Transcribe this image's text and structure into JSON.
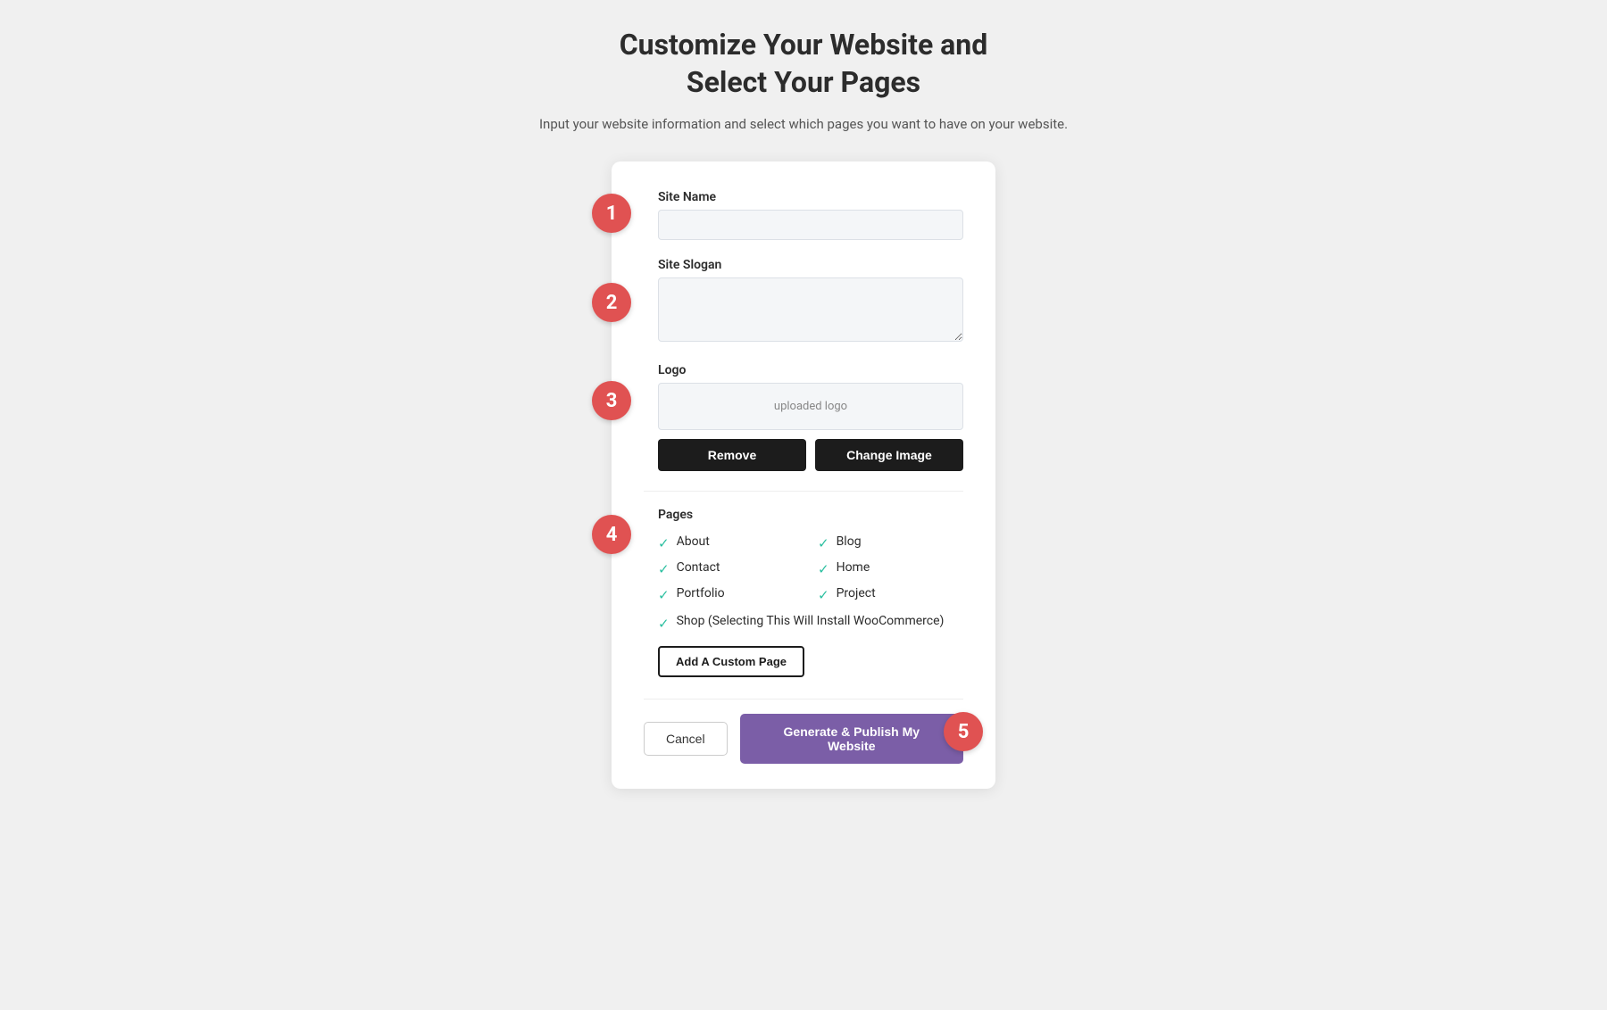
{
  "header": {
    "title_line1": "Customize Your Website and",
    "title_line2": "Select Your Pages",
    "subtitle": "Input your website information and select which pages you want to have on your website."
  },
  "form": {
    "site_name_label": "Site Name",
    "site_name_placeholder": "",
    "site_slogan_label": "Site Slogan",
    "site_slogan_placeholder": "",
    "logo_label": "Logo",
    "logo_placeholder": "uploaded logo",
    "remove_button": "Remove",
    "change_image_button": "Change Image",
    "pages_label": "Pages",
    "pages": [
      {
        "name": "About",
        "checked": true
      },
      {
        "name": "Blog",
        "checked": true
      },
      {
        "name": "Contact",
        "checked": true
      },
      {
        "name": "Home",
        "checked": true
      },
      {
        "name": "Portfolio",
        "checked": true
      },
      {
        "name": "Project",
        "checked": true
      }
    ],
    "shop_page": "Shop (Selecting This Will Install WooCommerce)",
    "shop_checked": true,
    "add_custom_page_button": "Add A Custom Page",
    "cancel_button": "Cancel",
    "generate_button": "Generate & Publish My Website"
  },
  "steps": {
    "step1": "1",
    "step2": "2",
    "step3": "3",
    "step4": "4",
    "step5": "5"
  },
  "colors": {
    "badge": "#e05252",
    "check": "#2bbfa0",
    "generate_btn": "#7b5ea7"
  }
}
